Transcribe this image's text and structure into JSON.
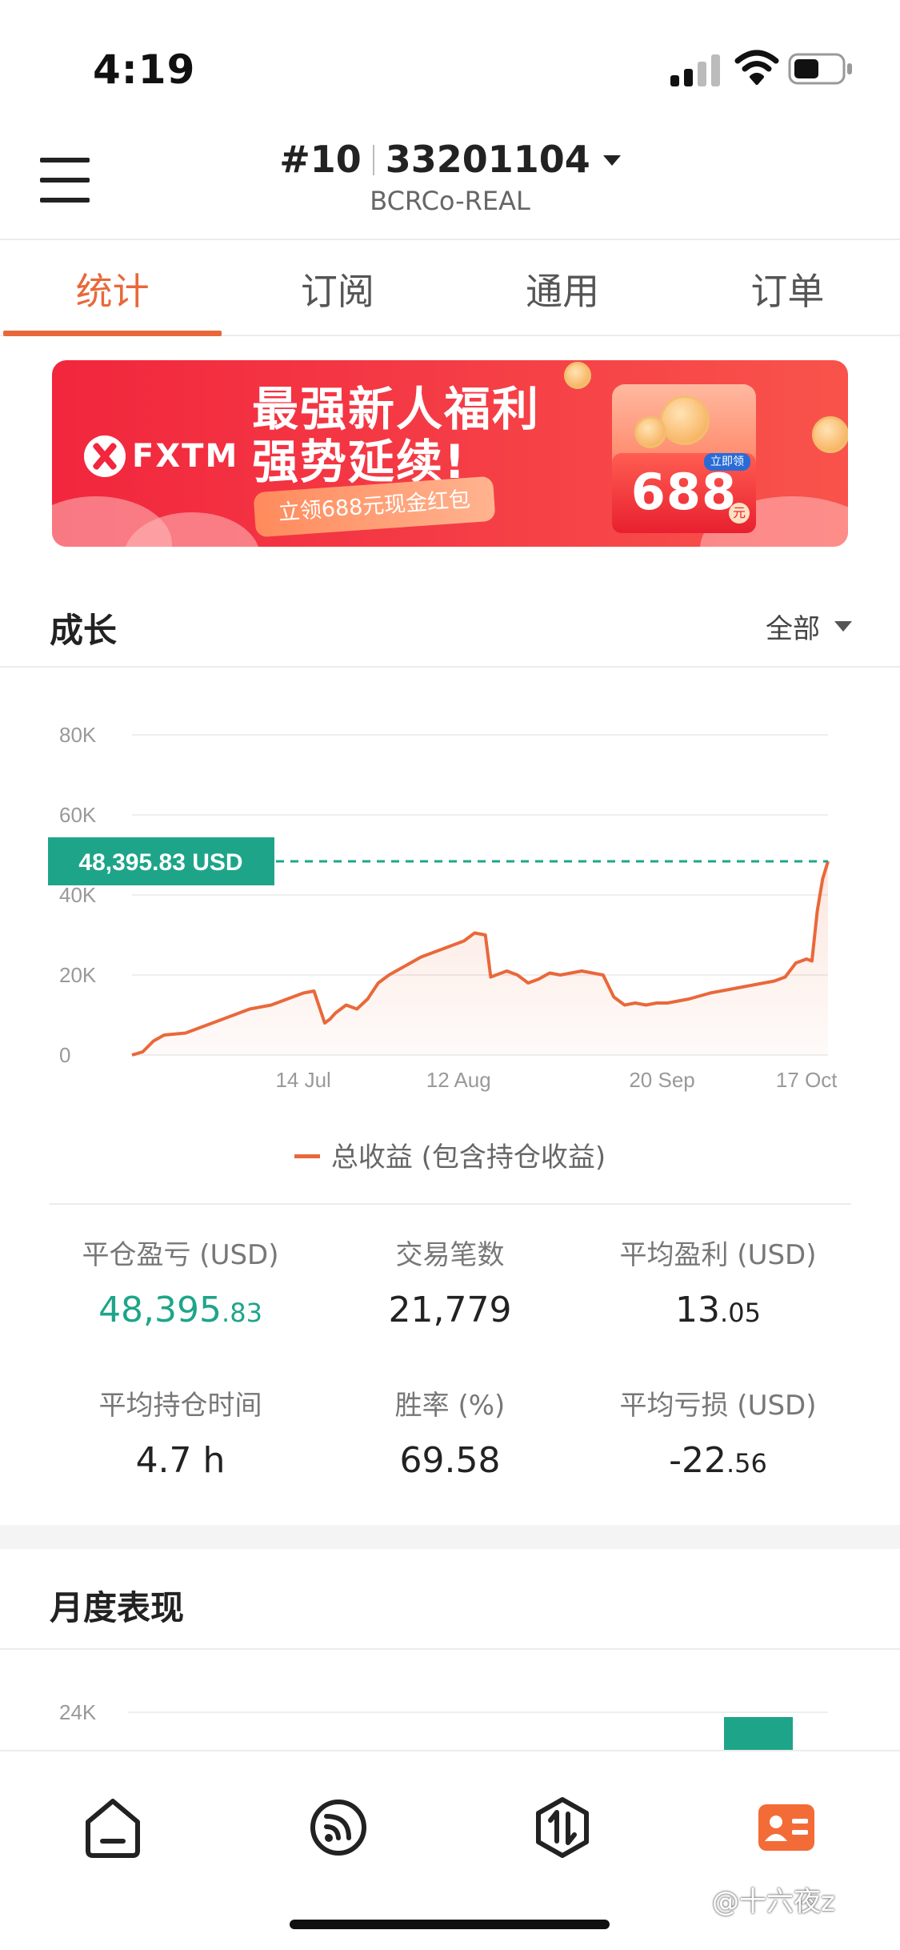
{
  "status_bar": {
    "time": "4:19"
  },
  "header": {
    "account_index": "#10",
    "account_number": "33201104",
    "server": "BCRCo-REAL"
  },
  "tabs": [
    {
      "label": "统计",
      "active": true
    },
    {
      "label": "订阅",
      "active": false
    },
    {
      "label": "通用",
      "active": false
    },
    {
      "label": "订单",
      "active": false
    }
  ],
  "banner": {
    "brand": "FXTM",
    "line1": "最强新人福利",
    "line2": "强势延续!",
    "ribbon": "立领688元现金红包",
    "amount": "688",
    "amount_tag": "立即领",
    "amount_unit": "元"
  },
  "growth": {
    "title": "成长",
    "range": "全部",
    "legend": "总收益 (包含持仓收益)"
  },
  "chart_data": {
    "type": "area",
    "title": "",
    "xlabel": "",
    "ylabel": "",
    "current_value_label": "48,395.83 USD",
    "current_value": 48395.83,
    "y_ticks": [
      "0",
      "20K",
      "40K",
      "60K",
      "80K"
    ],
    "ylim": [
      0,
      80000
    ],
    "x_ticks": [
      "14 Jul",
      "12 Aug",
      "20 Sep",
      "17 Oct"
    ],
    "x_tick_positions": [
      32,
      61,
      99,
      126
    ],
    "xlim": [
      0,
      130
    ],
    "grid": true,
    "series": [
      {
        "name": "总收益 (包含持仓收益)",
        "color": "#e9683a",
        "x": [
          0,
          2,
          4,
          6,
          10,
          14,
          18,
          22,
          26,
          28,
          30,
          32,
          34,
          36,
          37,
          38,
          40,
          42,
          44,
          46,
          48,
          50,
          54,
          58,
          62,
          64,
          66,
          67,
          68,
          70,
          72,
          74,
          76,
          78,
          80,
          82,
          84,
          86,
          88,
          90,
          92,
          94,
          96,
          98,
          100,
          104,
          108,
          112,
          116,
          120,
          122,
          124,
          126,
          127,
          128,
          129,
          130
        ],
        "y": [
          0,
          800,
          3500,
          5000,
          5500,
          7500,
          9500,
          11500,
          12500,
          13500,
          14500,
          15500,
          16000,
          8000,
          9000,
          10500,
          12500,
          11500,
          14000,
          18000,
          20000,
          21500,
          24500,
          26500,
          28500,
          30500,
          30000,
          19500,
          20000,
          21000,
          20000,
          18000,
          19000,
          20500,
          20000,
          20500,
          21000,
          20500,
          20000,
          14500,
          12500,
          13000,
          12500,
          13000,
          13000,
          14000,
          15500,
          16500,
          17500,
          18500,
          19500,
          23000,
          24000,
          23500,
          36000,
          44000,
          48395.83
        ]
      }
    ]
  },
  "stats": [
    {
      "label": "平仓盈亏 (USD)",
      "int": "48,395",
      "dec": ".83",
      "highlight": true
    },
    {
      "label": "交易笔数",
      "int": "21,779",
      "dec": "",
      "highlight": false
    },
    {
      "label": "平均盈利 (USD)",
      "int": "13",
      "dec": ".05",
      "highlight": false
    },
    {
      "label": "平均持仓时间",
      "int": "4.7 h",
      "dec": "",
      "highlight": false
    },
    {
      "label": "胜率 (%)",
      "int": "69.58",
      "dec": "",
      "highlight": false
    },
    {
      "label": "平均亏损 (USD)",
      "int": "-22",
      "dec": ".56",
      "highlight": false
    }
  ],
  "monthly": {
    "title": "月度表现",
    "y_tick": "24K",
    "bar_color": "#1ea589"
  },
  "bottom_nav": [
    {
      "icon": "home-icon",
      "active": false
    },
    {
      "icon": "feed-icon",
      "active": false
    },
    {
      "icon": "trade-icon",
      "active": false
    },
    {
      "icon": "profile-icon",
      "active": true
    }
  ],
  "watermark": "@十六夜z",
  "colors": {
    "accent": "#e9683a",
    "positive": "#1ea589",
    "banner_red": "#f2263d"
  }
}
